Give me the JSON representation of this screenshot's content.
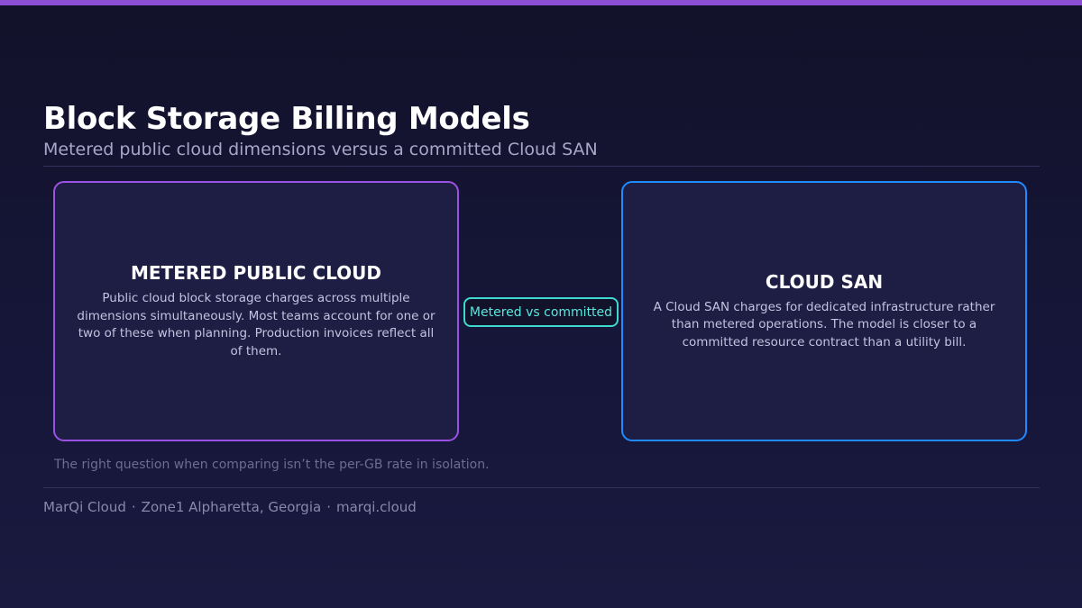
{
  "header": {
    "title": "Block Storage Billing Models",
    "subtitle": "Metered public cloud dimensions versus a committed Cloud SAN"
  },
  "cards": {
    "left": {
      "title": "METERED PUBLIC CLOUD",
      "body": "Public cloud block storage charges across multiple dimensions simultaneously. Most teams account for one or two of these when planning. Production invoices reflect all of them.",
      "border_color": "#9a52e4"
    },
    "right": {
      "title": "CLOUD SAN",
      "body": "A Cloud SAN charges for dedicated infrastructure rather than metered operations. The model is closer to a committed resource contract than a utility bill.",
      "border_color": "#1f8bff"
    }
  },
  "badge": {
    "label": "Metered vs committed",
    "color": "#3fd8cf"
  },
  "footnote": "The right question when comparing isn’t the per-GB rate in isolation.",
  "footer": {
    "company": "MarQi Cloud",
    "location": "Zone1 Alpharetta, Georgia",
    "website": "marqi.cloud",
    "separator": "·"
  },
  "colors": {
    "accent_bar": "#8b4fd6",
    "background": "#12122a"
  }
}
